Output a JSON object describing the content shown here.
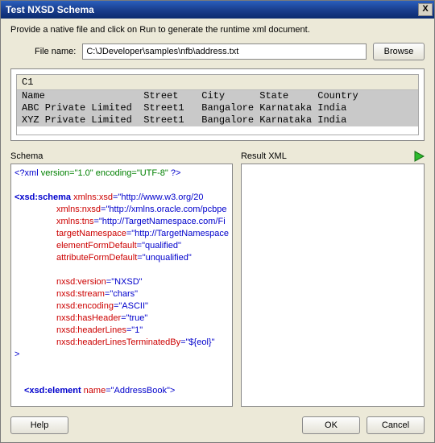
{
  "window": {
    "title": "Test NXSD Schema",
    "close": "X"
  },
  "instruction": "Provide a native file and click on Run to generate the runtime xml document.",
  "file": {
    "label": "File name:",
    "value": "C:\\JDeveloper\\samples\\nfb\\address.txt",
    "browse": "Browse"
  },
  "table": {
    "header": "C1",
    "rows": [
      "Name                 Street    City      State     Country",
      "ABC Private Limited  Street1   Bangalore Karnataka India",
      "XYZ Private Limited  Street1   Bangalore Karnataka India"
    ]
  },
  "schema": {
    "label": "Schema",
    "lines": {
      "l0a": "<?xml ",
      "l0b": "version=\"1.0\" encoding=\"UTF-8\"",
      "l0c": " ?>",
      "l1a": "<xsd:schema ",
      "l1b": "xmlns:xsd",
      "l1c": "=",
      "l1d": "\"http://www.w3.org/20",
      "l2a": "xmlns:nxsd",
      "l2b": "=",
      "l2c": "\"http://xmlns.oracle.com/pcbpe",
      "l3a": "xmlns:tns",
      "l3b": "=",
      "l3c": "\"http://TargetNamespace.com/Fi",
      "l4a": "targetNamespace",
      "l4b": "=",
      "l4c": "\"http://TargetNamespace",
      "l5a": "elementFormDefault",
      "l5b": "=",
      "l5c": "\"qualified\"",
      "l6a": "attributeFormDefault",
      "l6b": "=",
      "l6c": "\"unqualified\"",
      "l7a": "nxsd:version",
      "l7b": "=",
      "l7c": "\"NXSD\"",
      "l8a": "nxsd:stream",
      "l8b": "=",
      "l8c": "\"chars\"",
      "l9a": "nxsd:encoding",
      "l9b": "=",
      "l9c": "\"ASCII\"",
      "l10a": "nxsd:hasHeader",
      "l10b": "=",
      "l10c": "\"true\"",
      "l11a": "nxsd:headerLines",
      "l11b": "=",
      "l11c": "\"1\"",
      "l12a": "nxsd:headerLinesTerminatedBy",
      "l12b": "=",
      "l12c": "\"${eol}\"",
      "l13": ">",
      "l14a": "<xsd:element ",
      "l14b": "name",
      "l14c": "=",
      "l14d": "\"AddressBook\"",
      "l14e": ">"
    }
  },
  "result": {
    "label": "Result XML"
  },
  "footer": {
    "help": "Help",
    "ok": "OK",
    "cancel": "Cancel"
  }
}
